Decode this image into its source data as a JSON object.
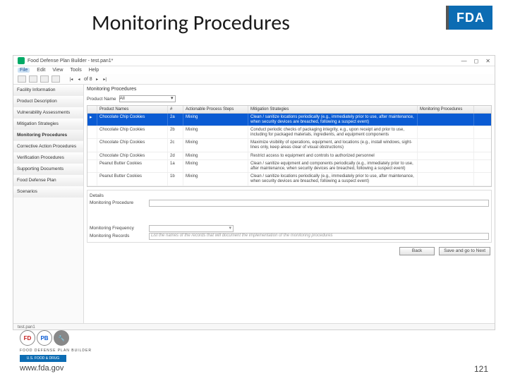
{
  "slide": {
    "title": "Monitoring Procedures",
    "fda_logo": "FDA",
    "website": "www.fda.gov",
    "page_number": "121"
  },
  "app": {
    "window_title": "Food Defense Plan Builder - test.pan1*",
    "menus": [
      "File",
      "Edit",
      "View",
      "Tools",
      "Help"
    ],
    "pager": "of 8",
    "sidebar": [
      "Facility Information",
      "Product Description",
      "Vulnerability Assessments",
      "Mitigation Strategies",
      "Monitoring Procedures",
      "Corrective Action Procedures",
      "Verification Procedures",
      "Supporting Documents",
      "Food Defense Plan",
      "Scenarios"
    ],
    "section_header": "Monitoring Procedures",
    "product_filter_label": "Product Name",
    "product_filter_value": "All",
    "grid": {
      "columns": [
        "",
        "Product Names",
        "#",
        "Actionable Process Steps",
        "Mitigation Strategies",
        "Monitoring Procedures"
      ],
      "rows": [
        {
          "selected": true,
          "product": "Chocolate Chip Cookies",
          "num": "2a",
          "step": "Mixing",
          "mit": "Clean / sanitize locations periodically (e.g., immediately prior to use, after maintenance, when security devices are breached, following a suspect event)",
          "mp": ""
        },
        {
          "selected": false,
          "product": "Chocolate Chip Cookies",
          "num": "2b",
          "step": "Mixing",
          "mit": "Conduct periodic checks of packaging integrity, e.g., upon receipt and prior to use, including for packaged materials, ingredients, and equipment components",
          "mp": ""
        },
        {
          "selected": false,
          "product": "Chocolate Chip Cookies",
          "num": "2c",
          "step": "Mixing",
          "mit": "Maximize visibility of operations, equipment, and locations (e.g., install windows, sight-lines only, keep areas clear of visual obstructions)",
          "mp": ""
        },
        {
          "selected": false,
          "product": "Chocolate Chip Cookies",
          "num": "2d",
          "step": "Mixing",
          "mit": "Restrict access to equipment and controls to authorized personnel",
          "mp": ""
        },
        {
          "selected": false,
          "product": "Peanut Butter Cookies",
          "num": "1a",
          "step": "Mixing",
          "mit": "Clean / sanitize equipment and components periodically (e.g., immediately prior to use, after maintenance, when security devices are breached, following a suspect event)",
          "mp": ""
        },
        {
          "selected": false,
          "product": "Peanut Butter Cookies",
          "num": "1b",
          "step": "Mixing",
          "mit": "Clean / sanitize locations periodically (e.g., immediately prior to use, after maintenance, when security devices are breached, following a suspect event)",
          "mp": ""
        }
      ]
    },
    "details": {
      "header": "Details",
      "procedure_label": "Monitoring Procedure",
      "frequency_label": "Monitoring Frequency",
      "records_label": "Monitoring Records",
      "records_placeholder": "List the names of the records that will document the implementation of the monitoring procedures"
    },
    "buttons": {
      "back": "Back",
      "next": "Save and go to Next"
    },
    "statusbar": "test.pan1"
  },
  "badges": {
    "fdpb_text": "FOOD DEFENSE PLAN BUILDER",
    "fda_text": "U.S. FOOD & DRUG"
  }
}
